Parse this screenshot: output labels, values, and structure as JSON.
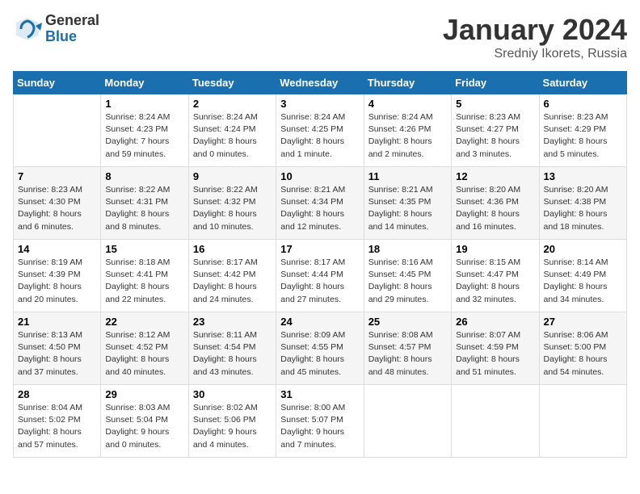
{
  "logo": {
    "general": "General",
    "blue": "Blue"
  },
  "title": "January 2024",
  "location": "Sredniy Ikorets, Russia",
  "days_of_week": [
    "Sunday",
    "Monday",
    "Tuesday",
    "Wednesday",
    "Thursday",
    "Friday",
    "Saturday"
  ],
  "weeks": [
    [
      {
        "day": "",
        "info": ""
      },
      {
        "day": "1",
        "info": "Sunrise: 8:24 AM\nSunset: 4:23 PM\nDaylight: 7 hours\nand 59 minutes."
      },
      {
        "day": "2",
        "info": "Sunrise: 8:24 AM\nSunset: 4:24 PM\nDaylight: 8 hours\nand 0 minutes."
      },
      {
        "day": "3",
        "info": "Sunrise: 8:24 AM\nSunset: 4:25 PM\nDaylight: 8 hours\nand 1 minute."
      },
      {
        "day": "4",
        "info": "Sunrise: 8:24 AM\nSunset: 4:26 PM\nDaylight: 8 hours\nand 2 minutes."
      },
      {
        "day": "5",
        "info": "Sunrise: 8:23 AM\nSunset: 4:27 PM\nDaylight: 8 hours\nand 3 minutes."
      },
      {
        "day": "6",
        "info": "Sunrise: 8:23 AM\nSunset: 4:29 PM\nDaylight: 8 hours\nand 5 minutes."
      }
    ],
    [
      {
        "day": "7",
        "info": "Sunrise: 8:23 AM\nSunset: 4:30 PM\nDaylight: 8 hours\nand 6 minutes."
      },
      {
        "day": "8",
        "info": "Sunrise: 8:22 AM\nSunset: 4:31 PM\nDaylight: 8 hours\nand 8 minutes."
      },
      {
        "day": "9",
        "info": "Sunrise: 8:22 AM\nSunset: 4:32 PM\nDaylight: 8 hours\nand 10 minutes."
      },
      {
        "day": "10",
        "info": "Sunrise: 8:21 AM\nSunset: 4:34 PM\nDaylight: 8 hours\nand 12 minutes."
      },
      {
        "day": "11",
        "info": "Sunrise: 8:21 AM\nSunset: 4:35 PM\nDaylight: 8 hours\nand 14 minutes."
      },
      {
        "day": "12",
        "info": "Sunrise: 8:20 AM\nSunset: 4:36 PM\nDaylight: 8 hours\nand 16 minutes."
      },
      {
        "day": "13",
        "info": "Sunrise: 8:20 AM\nSunset: 4:38 PM\nDaylight: 8 hours\nand 18 minutes."
      }
    ],
    [
      {
        "day": "14",
        "info": "Sunrise: 8:19 AM\nSunset: 4:39 PM\nDaylight: 8 hours\nand 20 minutes."
      },
      {
        "day": "15",
        "info": "Sunrise: 8:18 AM\nSunset: 4:41 PM\nDaylight: 8 hours\nand 22 minutes."
      },
      {
        "day": "16",
        "info": "Sunrise: 8:17 AM\nSunset: 4:42 PM\nDaylight: 8 hours\nand 24 minutes."
      },
      {
        "day": "17",
        "info": "Sunrise: 8:17 AM\nSunset: 4:44 PM\nDaylight: 8 hours\nand 27 minutes."
      },
      {
        "day": "18",
        "info": "Sunrise: 8:16 AM\nSunset: 4:45 PM\nDaylight: 8 hours\nand 29 minutes."
      },
      {
        "day": "19",
        "info": "Sunrise: 8:15 AM\nSunset: 4:47 PM\nDaylight: 8 hours\nand 32 minutes."
      },
      {
        "day": "20",
        "info": "Sunrise: 8:14 AM\nSunset: 4:49 PM\nDaylight: 8 hours\nand 34 minutes."
      }
    ],
    [
      {
        "day": "21",
        "info": "Sunrise: 8:13 AM\nSunset: 4:50 PM\nDaylight: 8 hours\nand 37 minutes."
      },
      {
        "day": "22",
        "info": "Sunrise: 8:12 AM\nSunset: 4:52 PM\nDaylight: 8 hours\nand 40 minutes."
      },
      {
        "day": "23",
        "info": "Sunrise: 8:11 AM\nSunset: 4:54 PM\nDaylight: 8 hours\nand 43 minutes."
      },
      {
        "day": "24",
        "info": "Sunrise: 8:09 AM\nSunset: 4:55 PM\nDaylight: 8 hours\nand 45 minutes."
      },
      {
        "day": "25",
        "info": "Sunrise: 8:08 AM\nSunset: 4:57 PM\nDaylight: 8 hours\nand 48 minutes."
      },
      {
        "day": "26",
        "info": "Sunrise: 8:07 AM\nSunset: 4:59 PM\nDaylight: 8 hours\nand 51 minutes."
      },
      {
        "day": "27",
        "info": "Sunrise: 8:06 AM\nSunset: 5:00 PM\nDaylight: 8 hours\nand 54 minutes."
      }
    ],
    [
      {
        "day": "28",
        "info": "Sunrise: 8:04 AM\nSunset: 5:02 PM\nDaylight: 8 hours\nand 57 minutes."
      },
      {
        "day": "29",
        "info": "Sunrise: 8:03 AM\nSunset: 5:04 PM\nDaylight: 9 hours\nand 0 minutes."
      },
      {
        "day": "30",
        "info": "Sunrise: 8:02 AM\nSunset: 5:06 PM\nDaylight: 9 hours\nand 4 minutes."
      },
      {
        "day": "31",
        "info": "Sunrise: 8:00 AM\nSunset: 5:07 PM\nDaylight: 9 hours\nand 7 minutes."
      },
      {
        "day": "",
        "info": ""
      },
      {
        "day": "",
        "info": ""
      },
      {
        "day": "",
        "info": ""
      }
    ]
  ]
}
